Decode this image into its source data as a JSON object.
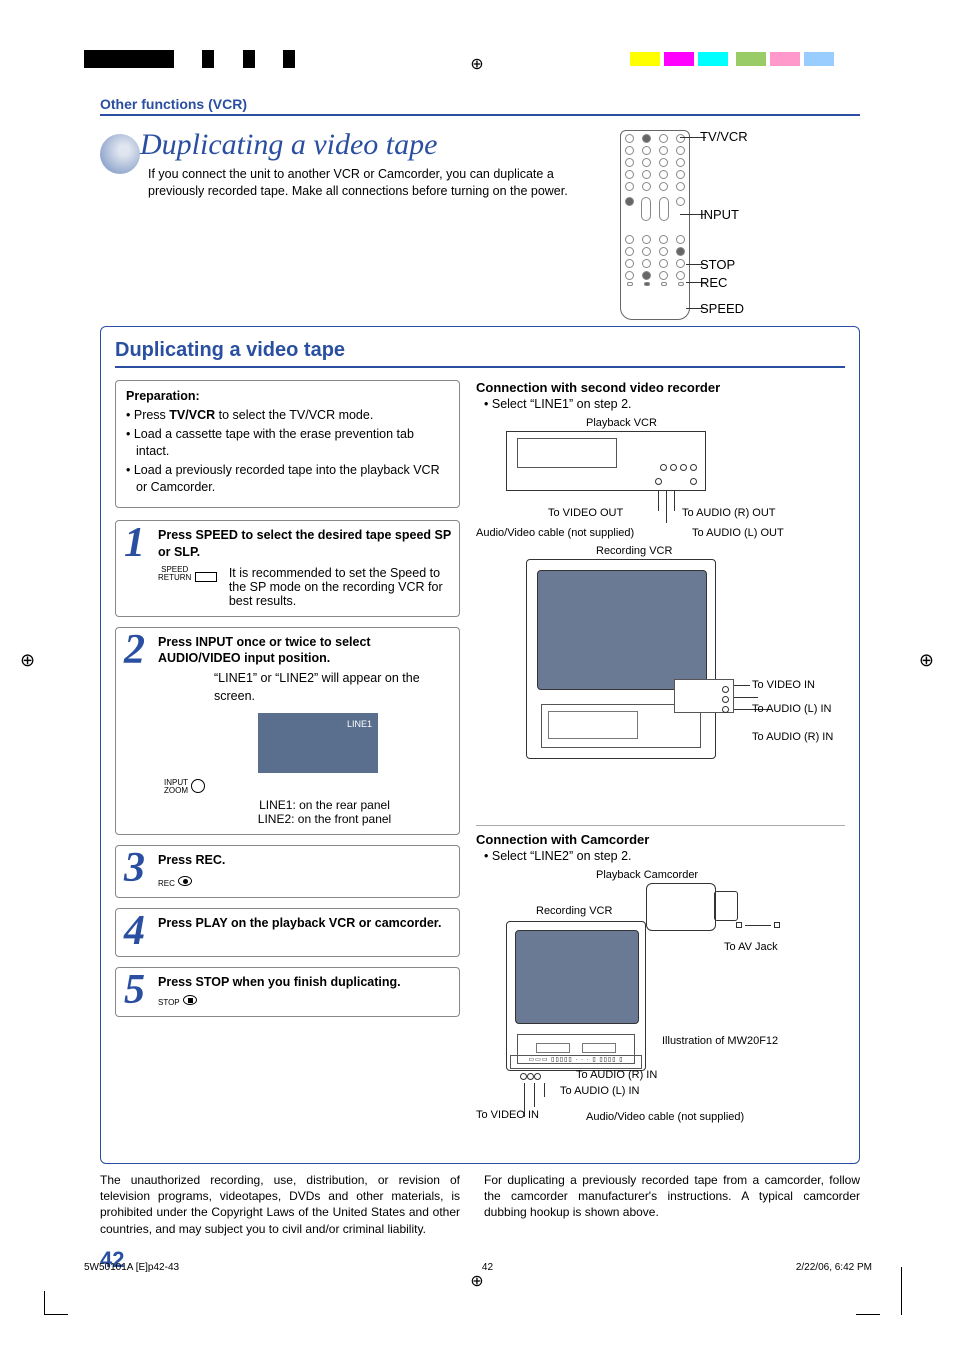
{
  "header": {
    "section": "Other functions (VCR)"
  },
  "title": {
    "heading": "Duplicating a video tape",
    "intro": "If you connect the unit to another VCR or Camcorder, you can duplicate a previously recorded tape. Make all connections before turning on the power."
  },
  "remote_labels": {
    "tvvcr": "TV/VCR",
    "input": "INPUT",
    "stop": "STOP",
    "rec": "REC",
    "speed": "SPEED"
  },
  "main": {
    "heading": "Duplicating a video tape",
    "preparation": {
      "label": "Preparation:",
      "items": [
        {
          "pre": "Press ",
          "bold": "TV/VCR",
          "post": " to select the TV/VCR mode."
        },
        {
          "text": "Load a cassette tape with the erase prevention tab intact."
        },
        {
          "text": "Load a previously recorded tape into the playback VCR or Camcorder."
        }
      ]
    },
    "steps": [
      {
        "num": "1",
        "heading": "Press SPEED to select the desired tape speed SP or SLP.",
        "icon_label": "SPEED\nRETURN",
        "body": "It is recommended to set the Speed to the SP mode on the recording VCR for best results."
      },
      {
        "num": "2",
        "heading": "Press INPUT once or twice to select AUDIO/VIDEO input position.",
        "icon_label": "INPUT\nZOOM",
        "body": "“LINE1” or “LINE2” will appear on the screen.",
        "screen_text": "LINE1",
        "caption1": "LINE1: on the rear panel",
        "caption2": "LINE2: on the front panel"
      },
      {
        "num": "3",
        "heading": "Press REC.",
        "icon_label": "REC"
      },
      {
        "num": "4",
        "heading": "Press PLAY on the playback VCR or camcorder."
      },
      {
        "num": "5",
        "heading": "Press STOP when you finish duplicating.",
        "icon_label": "STOP"
      }
    ],
    "right": {
      "sec1_title": "Connection with second video recorder",
      "sec1_bullet": "Select “LINE1” on step 2.",
      "d1": {
        "playback_vcr": "Playback VCR",
        "to_video_out": "To VIDEO OUT",
        "to_audio_r_out": "To AUDIO (R) OUT",
        "to_audio_l_out": "To AUDIO (L) OUT",
        "av_cable": "Audio/Video cable (not supplied)",
        "recording_vcr": "Recording VCR",
        "to_video_in": "To VIDEO IN",
        "to_audio_l_in": "To AUDIO (L) IN",
        "to_audio_r_in": "To AUDIO (R) IN"
      },
      "sec2_title": "Connection with Camcorder",
      "sec2_bullet": "Select “LINE2” on step 2.",
      "d2": {
        "playback_camcorder": "Playback Camcorder",
        "recording_vcr": "Recording VCR",
        "to_av_jack": "To AV Jack",
        "illustration": "Illustration of MW20F12",
        "to_audio_r_in": "To AUDIO (R) IN",
        "to_audio_l_in": "To AUDIO (L) IN",
        "to_video_in": "To VIDEO IN",
        "av_cable": "Audio/Video cable (not supplied)"
      },
      "camcorder_note": "For duplicating a previously recorded tape from a camcorder, follow the camcorder manufacturer's instructions. A typical camcorder dubbing hookup is shown above."
    },
    "copyright_note": "The unauthorized recording, use, distribution, or revision of television programs, videotapes, DVDs and other materials, is prohibited under the Copyright Laws of the United States and other countries, and may subject you to civil and/or criminal liability."
  },
  "page_number": "42",
  "footer": {
    "left": "5W50101A [E]p42-43",
    "center": "42",
    "right": "2/22/06, 6:42 PM"
  }
}
